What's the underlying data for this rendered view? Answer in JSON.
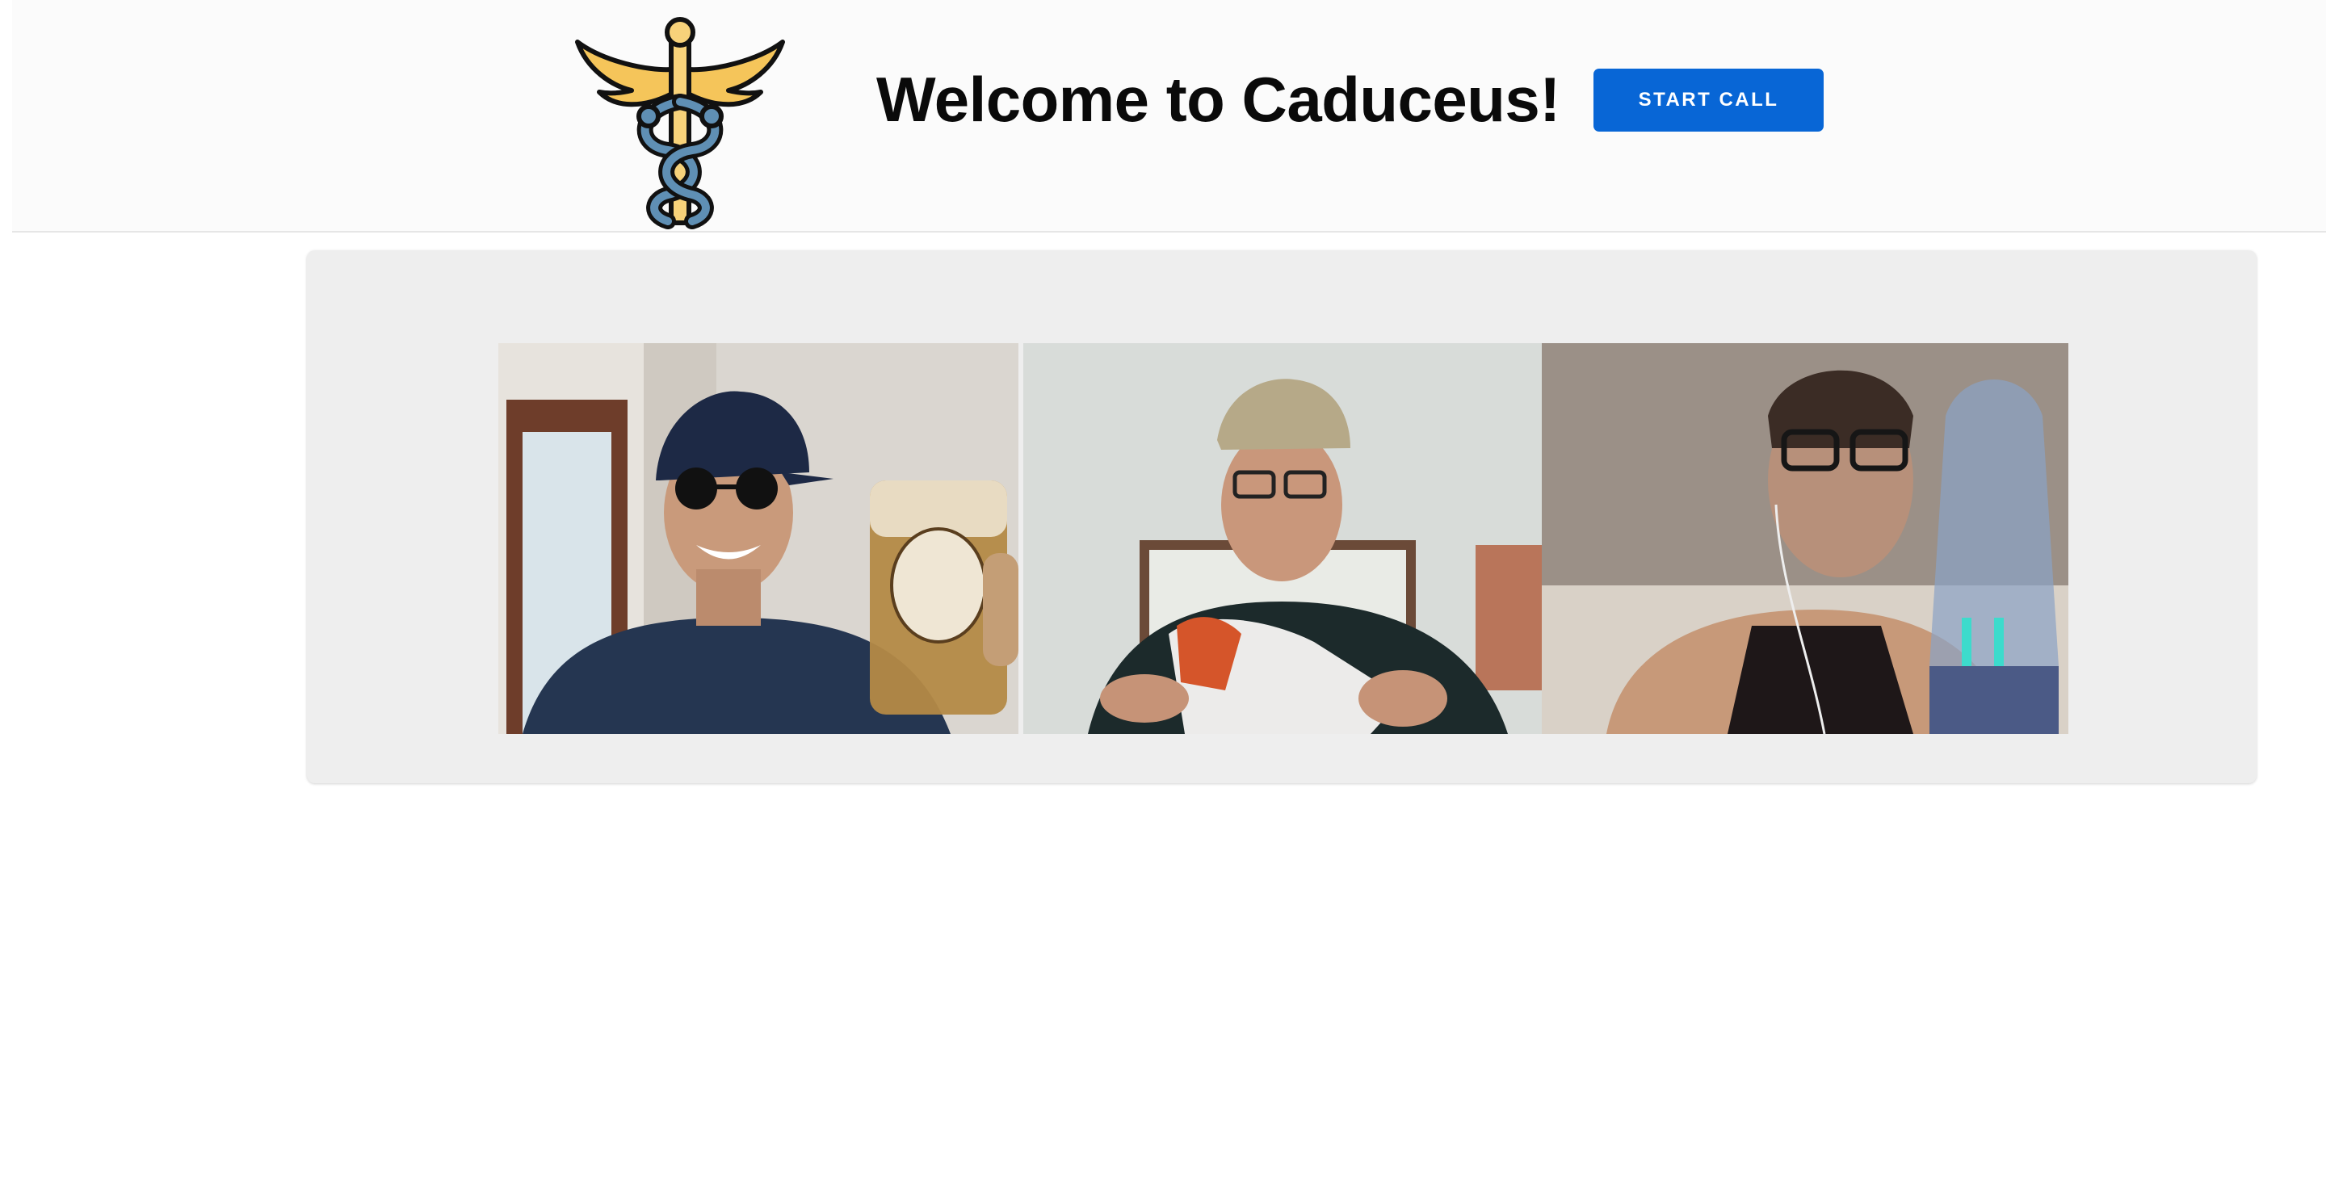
{
  "header": {
    "logo_icon": "caduceus-icon",
    "title": "Welcome to Caduceus!",
    "start_call_label": "START CALL"
  },
  "call": {
    "participants": [
      {
        "tile": "video-tile-1",
        "depicts": "participant-with-mug"
      },
      {
        "tile": "video-tile-2",
        "depicts": "participant-with-snack-bag"
      },
      {
        "tile": "video-tile-3",
        "depicts": "participant-with-glasses"
      }
    ]
  },
  "colors": {
    "accent": "#0866d6",
    "header_bg": "#fbfbfb",
    "panel_bg": "#eeeeee"
  }
}
